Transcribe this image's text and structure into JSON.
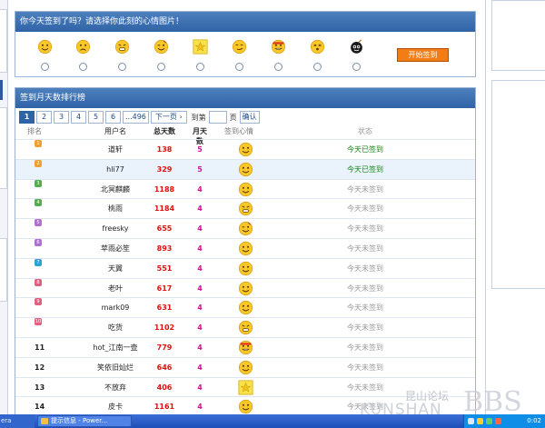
{
  "signin": {
    "title": "你今天签到了吗？请选择你此刻的心情图片！",
    "start_label": "开始签到",
    "moods": [
      "happy",
      "sad",
      "upset",
      "wink",
      "star",
      "sly",
      "cool",
      "dizzy",
      "bomb"
    ]
  },
  "ranking": {
    "title": "签到月天数排行榜",
    "pager": {
      "pages": [
        "1",
        "2",
        "3",
        "4",
        "5",
        "6",
        "...496"
      ],
      "next_label": "下一页",
      "goto_label": "到第",
      "page_label": "页",
      "confirm_label": "确认"
    },
    "headers": {
      "rank": "排名",
      "user": "用户名",
      "total": "总天数",
      "month": "月天数",
      "mood": "签到心情",
      "status": "状态"
    },
    "rows": [
      {
        "rank": "1",
        "user": "道轩",
        "total": "138",
        "month": "5",
        "mood": "happy",
        "status": "今天已签到",
        "done": true
      },
      {
        "rank": "2",
        "user": "hli77",
        "total": "329",
        "month": "5",
        "mood": "happy",
        "status": "今天已签到",
        "done": true
      },
      {
        "rank": "3",
        "user": "北冥麒麟",
        "total": "1188",
        "month": "4",
        "mood": "happy",
        "status": "今天未签到",
        "done": false
      },
      {
        "rank": "4",
        "user": "桃雨",
        "total": "1184",
        "month": "4",
        "mood": "upset",
        "status": "今天未签到",
        "done": false
      },
      {
        "rank": "5",
        "user": "freesky",
        "total": "655",
        "month": "4",
        "mood": "wink",
        "status": "今天未签到",
        "done": false
      },
      {
        "rank": "6",
        "user": "苹雨必笙",
        "total": "893",
        "month": "4",
        "mood": "happy",
        "status": "今天未签到",
        "done": false
      },
      {
        "rank": "7",
        "user": "天翼",
        "total": "551",
        "month": "4",
        "mood": "happy",
        "status": "今天未签到",
        "done": false
      },
      {
        "rank": "8",
        "user": "老叶",
        "total": "617",
        "month": "4",
        "mood": "happy",
        "status": "今天未签到",
        "done": false
      },
      {
        "rank": "9",
        "user": "mark09",
        "total": "631",
        "month": "4",
        "mood": "happy",
        "status": "今天未签到",
        "done": false
      },
      {
        "rank": "10",
        "user": "吃货",
        "total": "1102",
        "month": "4",
        "mood": "upset",
        "status": "今天未签到",
        "done": false
      },
      {
        "rank": "11",
        "user": "hot_江南一壶",
        "total": "779",
        "month": "4",
        "mood": "cool",
        "status": "今天未签到",
        "done": false
      },
      {
        "rank": "12",
        "user": "笑依旧灿烂",
        "total": "646",
        "month": "4",
        "mood": "happy",
        "status": "今天未签到",
        "done": false
      },
      {
        "rank": "13",
        "user": "不放弃",
        "total": "406",
        "month": "4",
        "mood": "star",
        "status": "今天未签到",
        "done": false
      },
      {
        "rank": "14",
        "user": "皮卡",
        "total": "1161",
        "month": "4",
        "mood": "happy",
        "status": "今天未签到",
        "done": false
      }
    ],
    "rank_badge_colors": [
      "#f0a030",
      "#f0a030",
      "#50b050",
      "#50b050",
      "#b070d0",
      "#b070d0",
      "#30a0d0",
      "#e06080",
      "#e06080",
      "#e06080"
    ]
  },
  "taskbar": {
    "left_text": "era",
    "item_label": "提示信息 - Power...",
    "clock": "0:02"
  },
  "watermark": {
    "top": "昆山论坛",
    "main": "KUNSHAN",
    "bbs": "BBS"
  },
  "colors": {
    "header_blue": "#2f63a7",
    "total_red": "#e01010",
    "month_magenta": "#d0109a",
    "done_green": "#118811",
    "start_orange": "#f27d15"
  }
}
